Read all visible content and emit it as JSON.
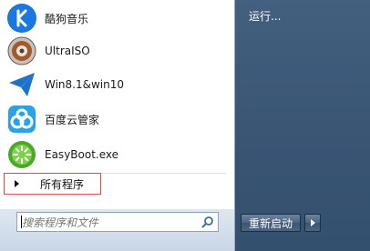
{
  "programs": [
    {
      "label": "酷狗音乐",
      "icon": "kugou-music-icon",
      "color": "#1a73d9"
    },
    {
      "label": "UltraISO",
      "icon": "ultraiso-disc-icon",
      "color": "#8b4a26"
    },
    {
      "label": "Win8.1&win10",
      "icon": "paper-plane-icon",
      "color": "#1e73c8"
    },
    {
      "label": "百度云管家",
      "icon": "baidu-cloud-icon",
      "color": "#2aa3e6"
    },
    {
      "label": "EasyBoot.exe",
      "icon": "easyboot-icon",
      "color": "#55b52a"
    }
  ],
  "all_programs": {
    "label": "所有程序",
    "highlight_color": "#e04848"
  },
  "search": {
    "placeholder": "搜索程序和文件"
  },
  "right_pane": {
    "run_label": "运行..."
  },
  "shutdown": {
    "label": "重新启动"
  }
}
